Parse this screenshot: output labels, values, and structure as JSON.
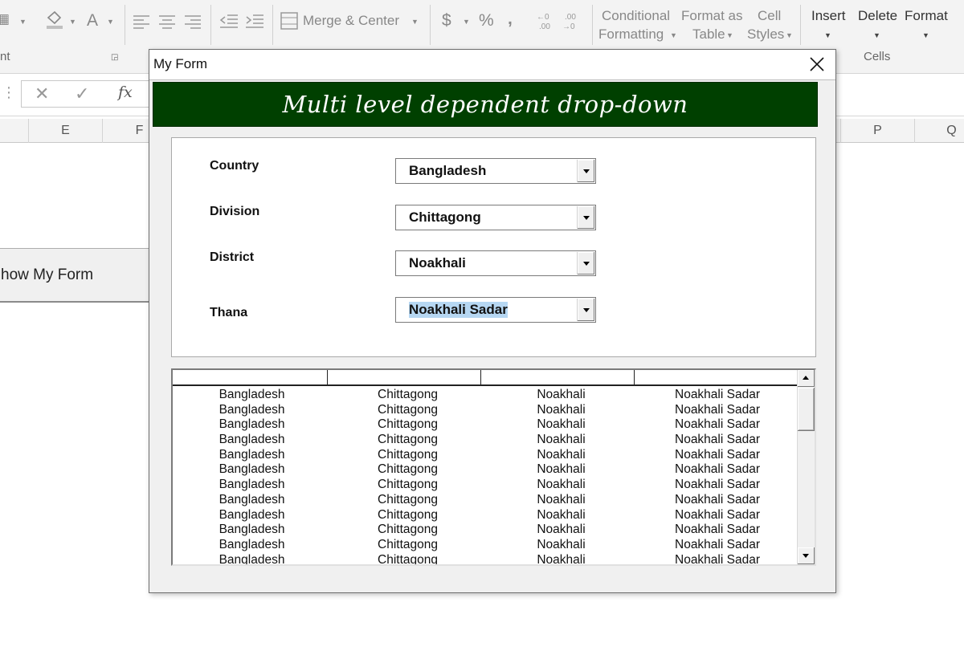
{
  "ribbon": {
    "merge_center": "Merge & Center",
    "currency": "$",
    "percent": "%",
    "comma": ",",
    "conditional_formatting_l1": "Conditional",
    "conditional_formatting_l2": "Formatting",
    "format_as_table_l1": "Format as",
    "format_as_table_l2": "Table",
    "cell_styles_l1": "Cell",
    "cell_styles_l2": "Styles",
    "insert": "Insert",
    "delete": "Delete",
    "format": "Format",
    "group_cells": "Cells",
    "group_font_partial": "nt",
    "font_color_glyph": "A"
  },
  "formula_bar": {
    "cancel_glyph": "✕",
    "enter_glyph": "✓",
    "fx_glyph": "fx"
  },
  "columns": [
    "E",
    "F",
    "P",
    "Q"
  ],
  "sheet": {
    "show_form_button": "how My Form"
  },
  "form": {
    "title": "My Form",
    "banner": "Multi level dependent drop-down",
    "fields": [
      {
        "label": "Country",
        "value": "Bangladesh"
      },
      {
        "label": "Division",
        "value": "Chittagong"
      },
      {
        "label": "District",
        "value": "Noakhali"
      },
      {
        "label": "Thana",
        "value": "Noakhali Sadar"
      }
    ],
    "list_rows": [
      [
        "Bangladesh",
        "Chittagong",
        "Noakhali",
        "Noakhali Sadar"
      ],
      [
        "Bangladesh",
        "Chittagong",
        "Noakhali",
        "Noakhali Sadar"
      ],
      [
        "Bangladesh",
        "Chittagong",
        "Noakhali",
        "Noakhali Sadar"
      ],
      [
        "Bangladesh",
        "Chittagong",
        "Noakhali",
        "Noakhali Sadar"
      ],
      [
        "Bangladesh",
        "Chittagong",
        "Noakhali",
        "Noakhali Sadar"
      ],
      [
        "Bangladesh",
        "Chittagong",
        "Noakhali",
        "Noakhali Sadar"
      ],
      [
        "Bangladesh",
        "Chittagong",
        "Noakhali",
        "Noakhali Sadar"
      ],
      [
        "Bangladesh",
        "Chittagong",
        "Noakhali",
        "Noakhali Sadar"
      ],
      [
        "Bangladesh",
        "Chittagong",
        "Noakhali",
        "Noakhali Sadar"
      ],
      [
        "Bangladesh",
        "Chittagong",
        "Noakhali",
        "Noakhali Sadar"
      ],
      [
        "Bangladesh",
        "Chittagong",
        "Noakhali",
        "Noakhali Sadar"
      ],
      [
        "Bangladesh",
        "Chittagong",
        "Noakhali",
        "Noakhali Sadar"
      ]
    ]
  },
  "colors": {
    "banner_bg": "#004000",
    "selection": "#b6d7f2"
  }
}
